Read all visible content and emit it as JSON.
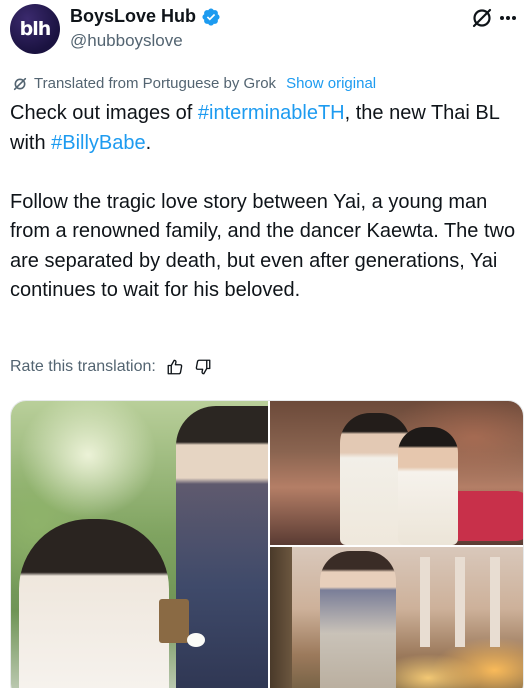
{
  "author": {
    "avatar_text": "blh",
    "display_name": "BoysLove Hub",
    "handle": "@hubboyslove",
    "verified": true,
    "verified_color": "#1d9bf0"
  },
  "header_icons": {
    "grok": "grok-icon",
    "more": "more-options-icon"
  },
  "translation": {
    "notice": "Translated from Portuguese by Grok",
    "show_original": "Show original"
  },
  "tweet": {
    "line1_before": "Check out images of ",
    "hashtag1": "#interminableTH",
    "line1_after": ", the new Thai BL with ",
    "hashtag2": "#BillyBabe",
    "line1_end": ".",
    "paragraph2": "Follow the tragic love story between Yai, a young man from a renowned family, and the dancer Kaewta. The two are separated by death, but even after generations, Yai continues to wait for his beloved."
  },
  "rate": {
    "label": "Rate this translation:",
    "thumbs_up": "thumbs-up-icon",
    "thumbs_down": "thumbs-down-icon"
  },
  "colors": {
    "text": "#0f1419",
    "secondary": "#536471",
    "link": "#1d9bf0"
  },
  "media": [
    {
      "name": "photo-1",
      "description_icon": "image"
    },
    {
      "name": "photo-2",
      "description_icon": "image"
    },
    {
      "name": "photo-3",
      "description_icon": "image"
    }
  ]
}
